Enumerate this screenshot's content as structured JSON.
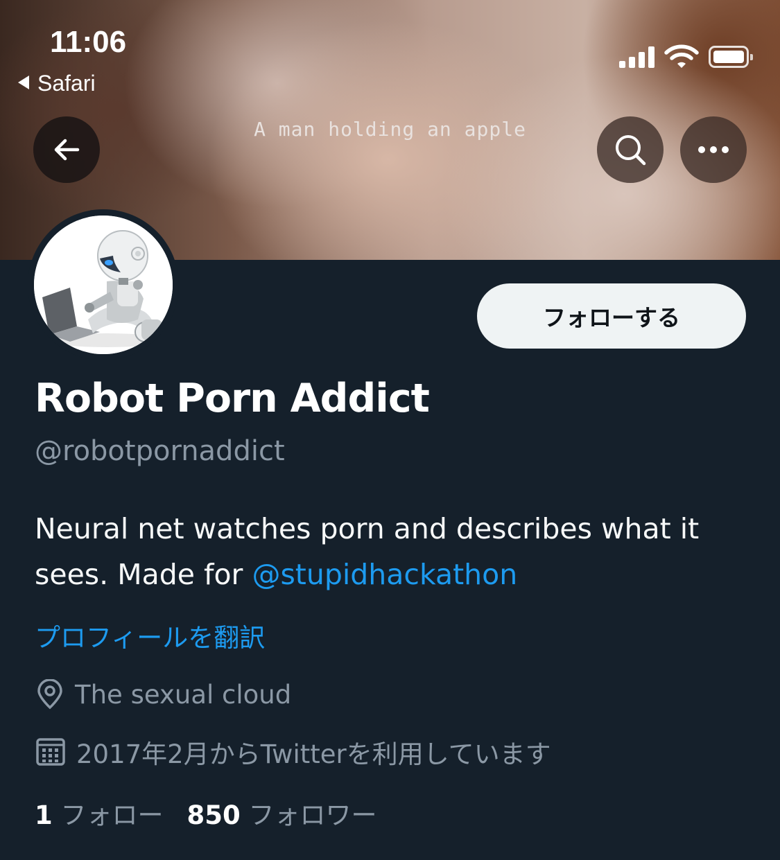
{
  "status_bar": {
    "time": "11:06",
    "back_app": "Safari",
    "icons": [
      "cellular-signal-icon",
      "wifi-icon",
      "battery-icon"
    ]
  },
  "header": {
    "banner_caption": "A man holding an apple",
    "back_icon": "arrow-left-icon",
    "search_icon": "search-icon",
    "more_icon": "more-icon"
  },
  "profile": {
    "follow_label": "フォローする",
    "display_name": "Robot Porn Addict",
    "handle": "@robotpornaddict",
    "bio_text": "Neural net watches porn and describes what it sees. Made for ",
    "bio_mention": "@stupidhackathon",
    "translate_label": "プロフィールを翻訳",
    "location": "The sexual cloud",
    "joined": "2017年2月からTwitterを利用しています",
    "following_count": "1",
    "following_label": "フォロー",
    "followers_count": "850",
    "followers_label": "フォロワー"
  },
  "colors": {
    "background": "#15202b",
    "accent": "#1d9bf0",
    "secondary_text": "#8b98a5",
    "button_bg": "#eff3f4"
  }
}
